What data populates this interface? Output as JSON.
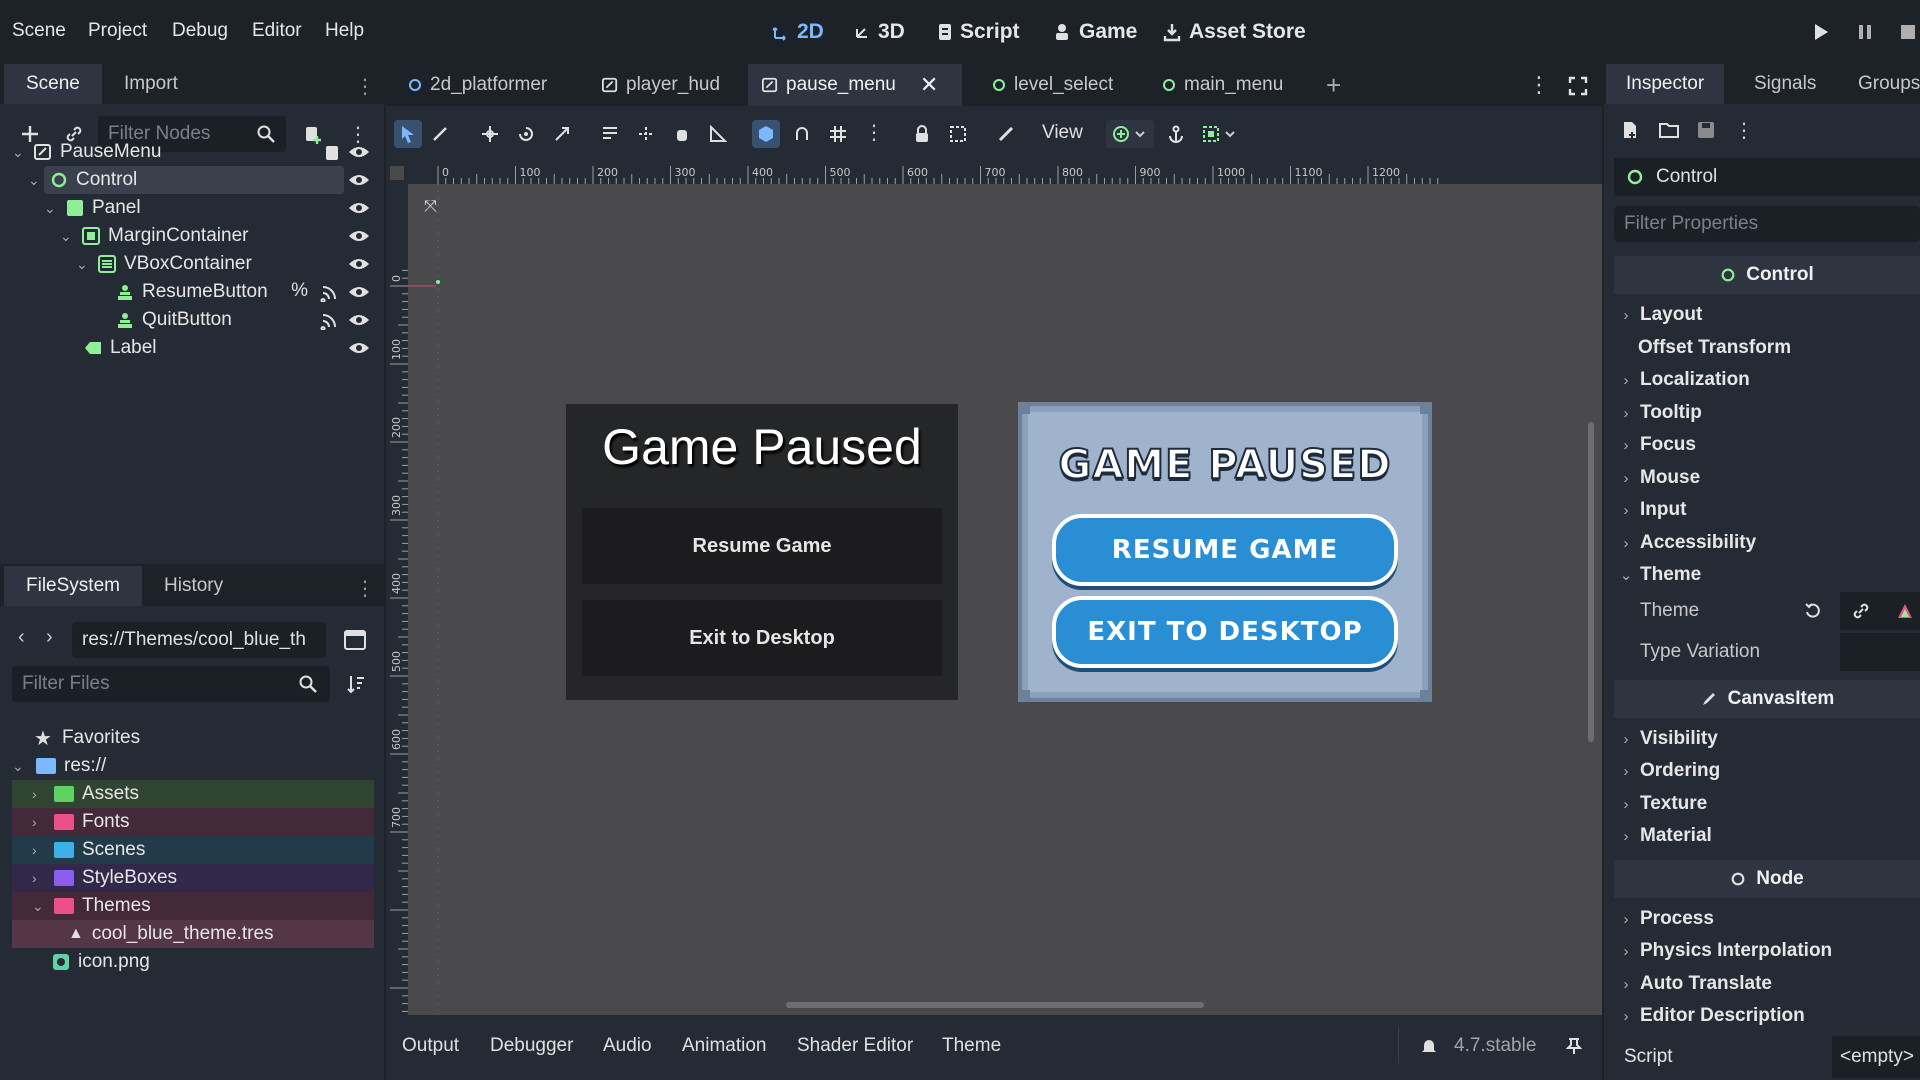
{
  "menu": [
    "Scene",
    "Project",
    "Debug",
    "Editor",
    "Help"
  ],
  "workspaces": {
    "2d": "2D",
    "3d": "3D",
    "script": "Script",
    "game": "Game",
    "asset_store": "Asset Store"
  },
  "scene_dock": {
    "tabs": [
      "Scene",
      "Import"
    ],
    "filter_placeholder": "Filter Nodes",
    "tree": [
      "PauseMenu",
      "Control",
      "Panel",
      "MarginContainer",
      "VBoxContainer",
      "ResumeButton",
      "QuitButton",
      "Label"
    ],
    "resume_badge": "%"
  },
  "fs_dock": {
    "tabs": [
      "FileSystem",
      "History"
    ],
    "path": "res://Themes/cool_blue_th",
    "filter_placeholder": "Filter Files",
    "items": [
      "Favorites",
      "res://",
      "Assets",
      "Fonts",
      "Scenes",
      "StyleBoxes",
      "Themes",
      "cool_blue_theme.tres",
      "icon.png"
    ]
  },
  "scene_tabs": [
    "2d_platformer",
    "player_hud",
    "pause_menu",
    "level_select",
    "main_menu"
  ],
  "toolbar": {
    "view_label": "View"
  },
  "ruler": {
    "h": [
      "0",
      "100",
      "200",
      "300",
      "400",
      "500",
      "600",
      "700",
      "800",
      "900",
      "1000",
      "1100",
      "1200"
    ],
    "v": [
      "0",
      "100",
      "200",
      "300",
      "400",
      "500",
      "600",
      "700"
    ]
  },
  "preview_default": {
    "title": "Game Paused",
    "resume": "Resume Game",
    "exit": "Exit to Desktop"
  },
  "preview_themed": {
    "title": "GAME PAUSED",
    "resume": "RESUME GAME",
    "exit": "EXIT TO DESKTOP"
  },
  "bottom_panel": {
    "tabs": [
      "Output",
      "Debugger",
      "Audio",
      "Animation",
      "Shader Editor",
      "Theme"
    ],
    "version": "4.7.stable"
  },
  "inspector": {
    "tabs": [
      "Inspector",
      "Signals",
      "Groups"
    ],
    "node_name": "Control",
    "filter_placeholder": "Filter Properties",
    "sections": {
      "control": "Control",
      "canvas_item": "CanvasItem",
      "node": "Node"
    },
    "control_props": [
      "Layout",
      "Offset Transform",
      "Localization",
      "Tooltip",
      "Focus",
      "Mouse",
      "Input",
      "Accessibility",
      "Theme"
    ],
    "theme_sub": {
      "theme": "Theme",
      "type_variation": "Type Variation"
    },
    "canvas_props": [
      "Visibility",
      "Ordering",
      "Texture",
      "Material"
    ],
    "node_props": [
      "Process",
      "Physics Interpolation",
      "Auto Translate",
      "Editor Description"
    ],
    "script_label": "Script",
    "script_value": "<empty>"
  },
  "colors": {
    "accent": "#7ab8ff",
    "control_node": "#8eef97",
    "themed_button": "#2a8ed4",
    "themed_frame": "#9fb4cc"
  }
}
